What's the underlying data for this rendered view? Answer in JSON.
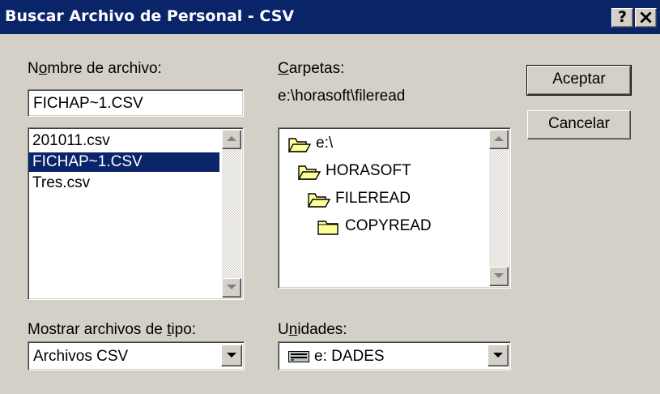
{
  "window": {
    "title": "Buscar Archivo de Personal - CSV",
    "help_button": "?",
    "close_button": "×"
  },
  "filename": {
    "label": "Nombre de archivo:",
    "value": "FICHAP~1.CSV",
    "files": [
      "201011.csv",
      "FICHAP~1.CSV",
      "Tres.csv"
    ],
    "selected_index": 1
  },
  "folders": {
    "label": "Carpetas:",
    "current_path": "e:\\horasoft\\fileread",
    "tree": [
      {
        "name": "e:\\",
        "icon": "open-folder-icon"
      },
      {
        "name": "HORASOFT",
        "icon": "open-folder-icon"
      },
      {
        "name": "FILEREAD",
        "icon": "open-folder-icon"
      },
      {
        "name": "COPYREAD",
        "icon": "closed-folder-icon"
      }
    ]
  },
  "buttons": {
    "ok": "Aceptar",
    "cancel": "Cancelar"
  },
  "file_type": {
    "label": "Mostrar archivos de tipo:",
    "selected": "Archivos CSV"
  },
  "drives": {
    "label": "Unidades:",
    "selected": "e: DADES",
    "icon": "drive-icon"
  },
  "colors": {
    "titlebar": "#0a246a",
    "selection": "#0a246a",
    "face": "#d4d0c8",
    "folder_yellow": "#ffff99"
  }
}
